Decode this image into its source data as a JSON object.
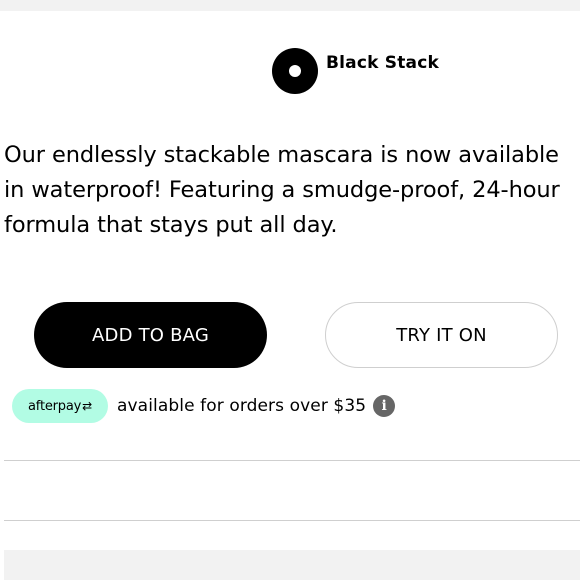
{
  "product": {
    "shade_name": "Black Stack",
    "swatch_color": "#000000",
    "description": "Our endlessly stackable mascara is now available in waterproof! Featuring a smudge-proof, 24-hour formula that stays put all day."
  },
  "actions": {
    "add_to_bag": "ADD TO BAG",
    "try_it_on": "TRY IT ON"
  },
  "afterpay": {
    "badge_label": "afterpay",
    "badge_glyph": "⇄",
    "badge_color": "#b2fce4",
    "message": "available for orders over $35",
    "info_glyph": "i",
    "info_icon": "info-icon"
  }
}
